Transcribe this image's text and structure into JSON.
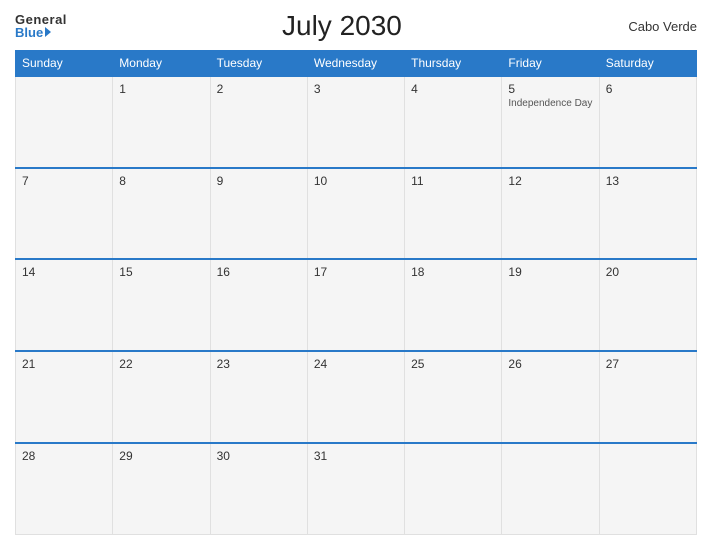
{
  "header": {
    "logo_general": "General",
    "logo_blue": "Blue",
    "title": "July 2030",
    "country": "Cabo Verde"
  },
  "days": [
    "Sunday",
    "Monday",
    "Tuesday",
    "Wednesday",
    "Thursday",
    "Friday",
    "Saturday"
  ],
  "weeks": [
    [
      {
        "date": "",
        "event": ""
      },
      {
        "date": "1",
        "event": ""
      },
      {
        "date": "2",
        "event": ""
      },
      {
        "date": "3",
        "event": ""
      },
      {
        "date": "4",
        "event": ""
      },
      {
        "date": "5",
        "event": "Independence Day"
      },
      {
        "date": "6",
        "event": ""
      }
    ],
    [
      {
        "date": "7",
        "event": ""
      },
      {
        "date": "8",
        "event": ""
      },
      {
        "date": "9",
        "event": ""
      },
      {
        "date": "10",
        "event": ""
      },
      {
        "date": "11",
        "event": ""
      },
      {
        "date": "12",
        "event": ""
      },
      {
        "date": "13",
        "event": ""
      }
    ],
    [
      {
        "date": "14",
        "event": ""
      },
      {
        "date": "15",
        "event": ""
      },
      {
        "date": "16",
        "event": ""
      },
      {
        "date": "17",
        "event": ""
      },
      {
        "date": "18",
        "event": ""
      },
      {
        "date": "19",
        "event": ""
      },
      {
        "date": "20",
        "event": ""
      }
    ],
    [
      {
        "date": "21",
        "event": ""
      },
      {
        "date": "22",
        "event": ""
      },
      {
        "date": "23",
        "event": ""
      },
      {
        "date": "24",
        "event": ""
      },
      {
        "date": "25",
        "event": ""
      },
      {
        "date": "26",
        "event": ""
      },
      {
        "date": "27",
        "event": ""
      }
    ],
    [
      {
        "date": "28",
        "event": ""
      },
      {
        "date": "29",
        "event": ""
      },
      {
        "date": "30",
        "event": ""
      },
      {
        "date": "31",
        "event": ""
      },
      {
        "date": "",
        "event": ""
      },
      {
        "date": "",
        "event": ""
      },
      {
        "date": "",
        "event": ""
      }
    ]
  ]
}
